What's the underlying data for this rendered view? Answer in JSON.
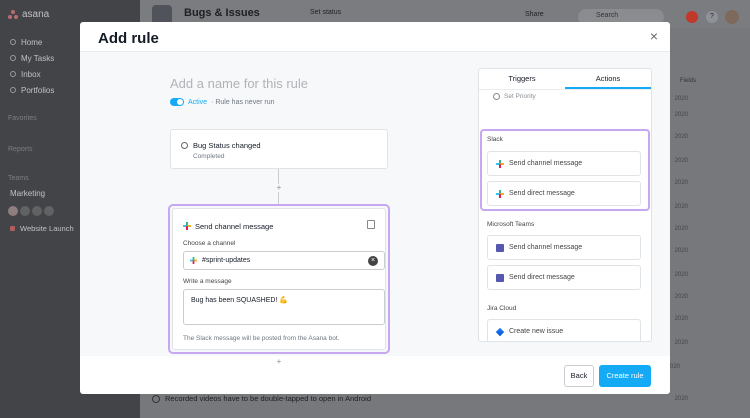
{
  "app": {
    "logo_text": "asana",
    "nav": [
      "Home",
      "My Tasks",
      "Inbox",
      "Portfolios"
    ],
    "sections": [
      "Favorites",
      "Reports",
      "Teams"
    ],
    "team_name": "Marketing",
    "project": "Website Launch",
    "project_title": "Bugs & Issues",
    "set_status": "Set status",
    "share": "Share",
    "search_placeholder": "Search",
    "help": "?",
    "background_task": "Recorded videos have to be double-tapped to open in Android",
    "column_partial": "Fields",
    "dates": [
      "2020",
      "2020",
      "2020",
      "2020",
      "2020",
      "2020",
      "2020",
      "2020",
      "2020",
      "2020",
      "2020",
      "2020",
      "Feb 14, 2020",
      "2020"
    ]
  },
  "modal": {
    "title": "Add rule",
    "close": "×",
    "rule_name_placeholder": "Add a name for this rule",
    "active_label": "Active",
    "never_run": "· Rule has never run",
    "trigger": {
      "title": "Bug Status changed",
      "subtitle": "Completed"
    },
    "action": {
      "title": "Send channel message",
      "choose_channel_label": "Choose a channel",
      "channel_value": "#sprint-updates",
      "clear": "×",
      "write_message_label": "Write a message",
      "message_value": "Bug has been SQUASHED! 💪",
      "note": "The Slack message will be posted from the Asana bot."
    },
    "panel": {
      "tabs": [
        "Triggers",
        "Actions"
      ],
      "active_tab": "Actions",
      "partial_item": "Set Priority",
      "sections": [
        {
          "title": "Slack",
          "items": [
            "Send channel message",
            "Send direct message"
          ]
        },
        {
          "title": "Microsoft Teams",
          "items": [
            "Send channel message",
            "Send direct message"
          ]
        },
        {
          "title": "Jira Cloud",
          "items": [
            "Create new issue"
          ]
        }
      ]
    },
    "footer": {
      "back": "Back",
      "create": "Create rule"
    }
  },
  "colors": {
    "accent": "#14aaf5",
    "highlight": "#c7a8f0",
    "slack": [
      "#36c5f0",
      "#2eb67d",
      "#ecb22e",
      "#e01e5a"
    ],
    "teams": "#5558af",
    "jira": "#2684ff"
  }
}
